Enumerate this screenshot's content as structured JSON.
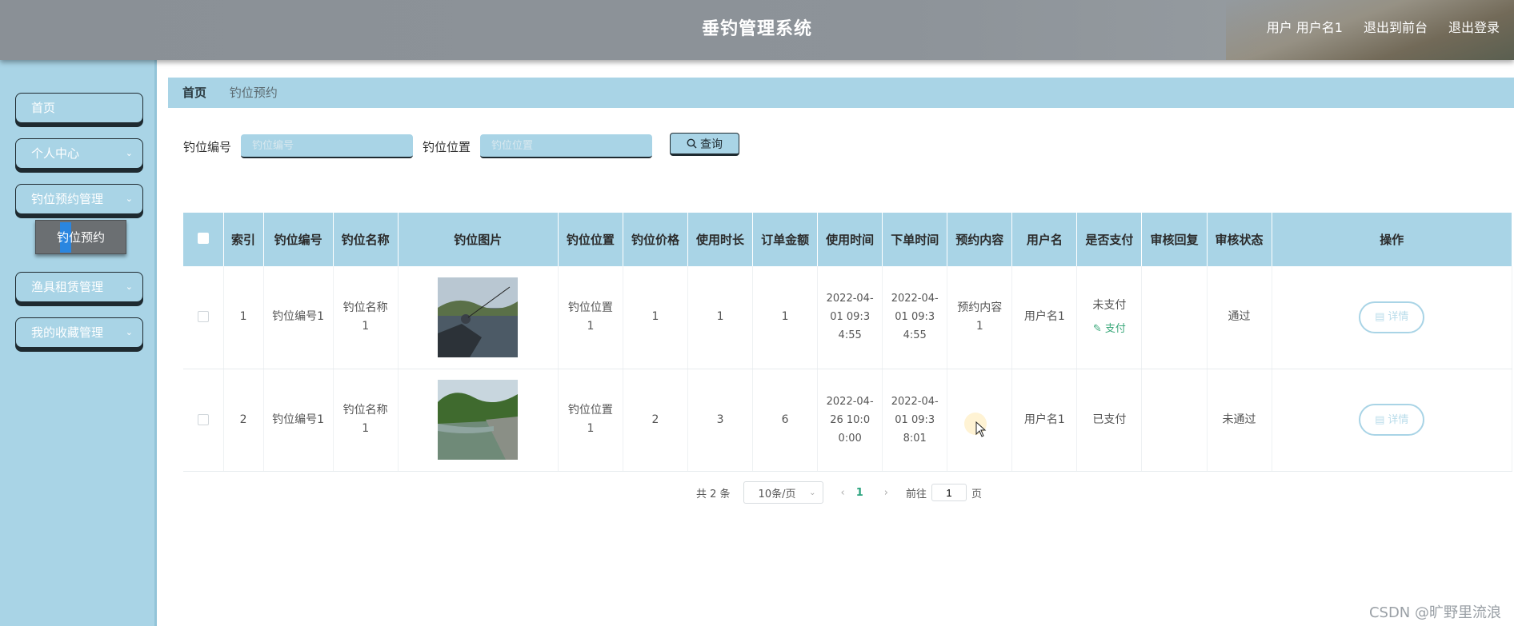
{
  "header": {
    "title": "垂钓管理系统",
    "user_label": "用户 用户名1",
    "to_front": "退出到前台",
    "logout": "退出登录"
  },
  "sidebar": {
    "items": [
      {
        "label": "首页",
        "chevron": false
      },
      {
        "label": "个人中心",
        "chevron": true
      },
      {
        "label": "钓位预约管理",
        "chevron": true
      },
      {
        "label": "渔具租赁管理",
        "chevron": true
      },
      {
        "label": "我的收藏管理",
        "chevron": true
      }
    ],
    "sub_item": "钓位预约"
  },
  "breadcrumb": {
    "home": "首页",
    "current": "钓位预约"
  },
  "search": {
    "field1_label": "钓位编号",
    "field1_placeholder": "钓位编号",
    "field2_label": "钓位位置",
    "field2_placeholder": "钓位位置",
    "button": "查询"
  },
  "table": {
    "headers": [
      "索引",
      "钓位编号",
      "钓位名称",
      "钓位图片",
      "钓位位置",
      "钓位价格",
      "使用时长",
      "订单金额",
      "使用时间",
      "下单时间",
      "预约内容",
      "用户名",
      "是否支付",
      "审核回复",
      "审核状态",
      "操作"
    ],
    "rows": [
      {
        "index": "1",
        "code": "钓位编号1",
        "name": "钓位名称1",
        "location": "钓位位置1",
        "price": "1",
        "duration": "1",
        "amount": "1",
        "use_time": "2022-04-01 09:34:55",
        "order_time": "2022-04-01 09:34:55",
        "content": "预约内容1",
        "username": "用户名1",
        "paid": "未支付",
        "pay_action": "支付",
        "reply": "",
        "status": "通过",
        "action": "详情"
      },
      {
        "index": "2",
        "code": "钓位编号1",
        "name": "钓位名称1",
        "location": "钓位位置1",
        "price": "2",
        "duration": "3",
        "amount": "6",
        "use_time": "2022-04-26 10:00:00",
        "order_time": "2022-04-01 09:38:01",
        "content": "",
        "username": "用户名1",
        "paid": "已支付",
        "pay_action": "",
        "reply": "",
        "status": "未通过",
        "action": "详情"
      }
    ]
  },
  "pagination": {
    "total_text": "共 2 条",
    "page_size": "10条/页",
    "current_page": "1",
    "goto_label": "前往",
    "goto_value": "1",
    "page_unit": "页"
  },
  "watermark": "CSDN @旷野里流浪"
}
